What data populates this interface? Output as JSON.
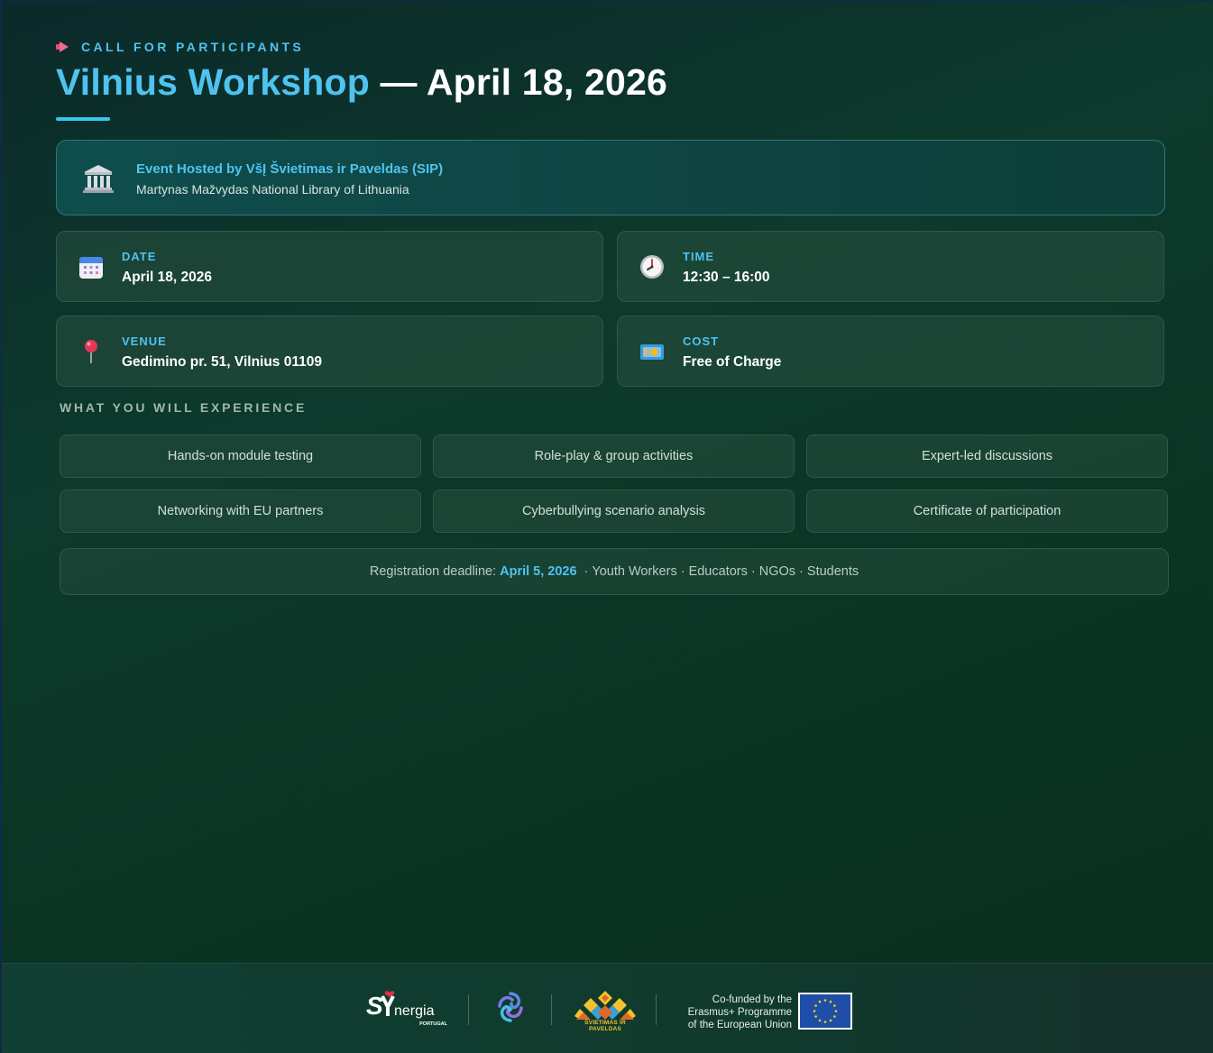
{
  "header": {
    "kicker": "CALL FOR PARTICIPANTS",
    "title_highlight": "Vilnius Workshop",
    "title_rest": " — April 18, 2026"
  },
  "host": {
    "title": "Event Hosted by VšĮ Švietimas ir Paveldas (SIP)",
    "subtitle": "Martynas Mažvydas National Library of Lithuania",
    "icon": "classical-building-icon"
  },
  "details": [
    {
      "label": "DATE",
      "value": "April 18, 2026",
      "icon": "calendar-icon"
    },
    {
      "label": "TIME",
      "value": "12:30 – 16:00",
      "icon": "clock-icon"
    },
    {
      "label": "VENUE",
      "value": "Gedimino pr. 51, Vilnius 01109",
      "icon": "map-pin-icon"
    },
    {
      "label": "COST",
      "value": "Free of Charge",
      "icon": "banknote-icon"
    }
  ],
  "experience": {
    "heading": "WHAT YOU WILL EXPERIENCE",
    "items": [
      "Hands-on module testing",
      "Role-play & group activities",
      "Expert-led discussions",
      "Networking with EU partners",
      "Cyberbullying scenario analysis",
      "Certificate of participation"
    ]
  },
  "deadline": {
    "label": "Registration deadline:",
    "date": "April 5, 2026",
    "separator": "·",
    "audience": "Youth Workers · Educators · NGOs · Students"
  },
  "footer": {
    "synergia_word": "nergia",
    "synergia_sub": "PORTUGAL",
    "svp_name": "ŠVIETIMAS IR PAVELDAS",
    "cofund_line1": "Co-funded by the",
    "cofund_line2": "Erasmus+ Programme",
    "cofund_line3": "of the European Union"
  },
  "colors": {
    "accent": "#4fc3f0",
    "accent_bar": "#33c8ee",
    "kicker_icon": "#f06a8a",
    "background": "#0d3a2c",
    "eu_blue": "#1f4ea8",
    "eu_star": "#f7d117"
  }
}
